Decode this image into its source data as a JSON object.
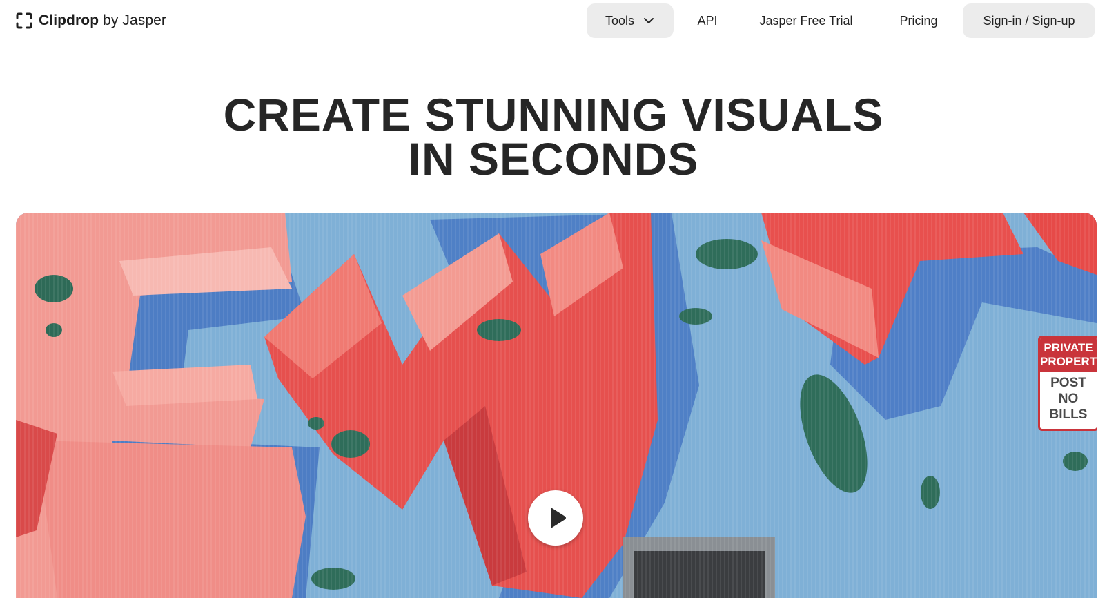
{
  "header": {
    "logo": {
      "brand": "Clipdrop",
      "suffix": "by Jasper",
      "icon": "bracket-frame-icon"
    },
    "nav": {
      "tools_label": "Tools",
      "api_label": "API",
      "trial_label": "Jasper Free Trial",
      "pricing_label": "Pricing",
      "signin_label": "Sign-in / Sign-up"
    }
  },
  "hero": {
    "title_line1": "CREATE STUNNING VISUALS",
    "title_line2": "IN SECONDS"
  },
  "video": {
    "play_icon": "play-icon",
    "sign": {
      "line1": "PRIVATE",
      "line2": "PROPERTY",
      "line3": "POST",
      "line4": "NO",
      "line5": "BILLS"
    }
  },
  "colors": {
    "button_bg": "#ececec",
    "title": "#262626",
    "wall_blue": "#7fb0d6",
    "graffiti_red": "#e8504e",
    "graffiti_pink": "#f29a93"
  }
}
